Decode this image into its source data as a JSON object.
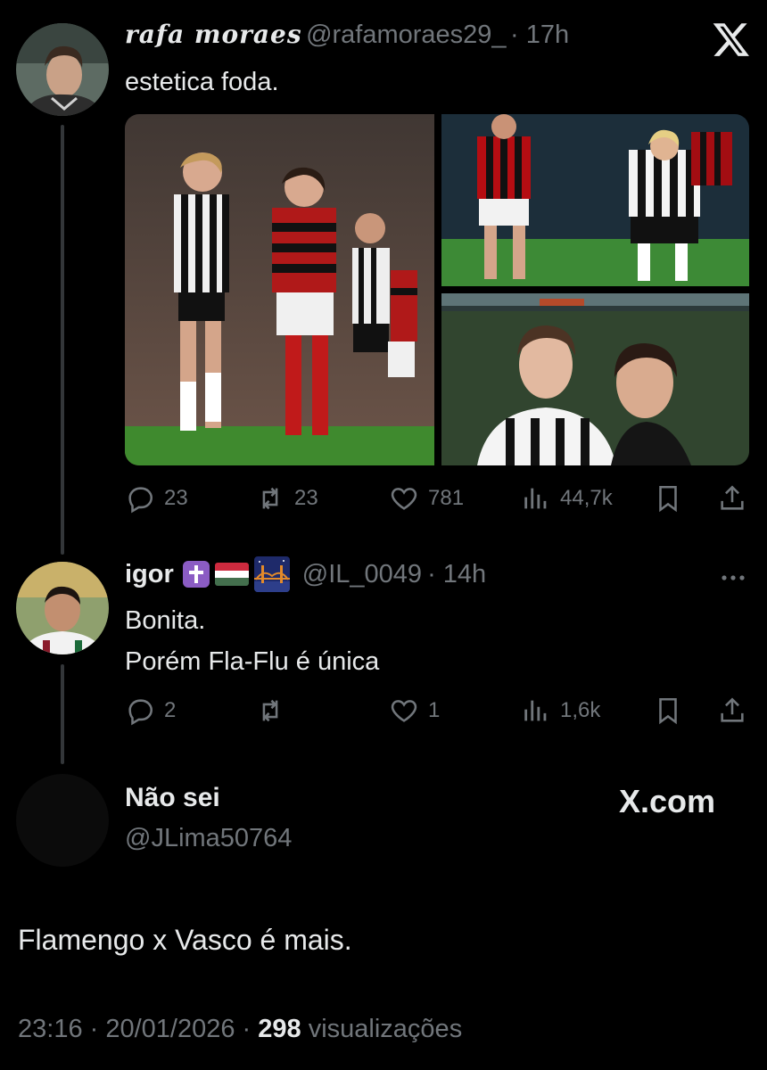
{
  "tweet": {
    "display_name": "rafa moraes",
    "handle": "@rafamoraes29_",
    "time": "· 17h",
    "text": "estetica foda.",
    "stats": {
      "replies": "23",
      "reposts": "23",
      "likes": "781",
      "views": "44,7k"
    }
  },
  "reply": {
    "display_name": "igor",
    "handle": "@IL_0049",
    "time": "· 14h",
    "text_line1": "Bonita.",
    "text_line2": "Porém Fla-Flu é única",
    "stats": {
      "replies": "2",
      "reposts": "",
      "likes": "1",
      "views": "1,6k"
    }
  },
  "quoted": {
    "display_name": "Não sei",
    "handle": "@JLima50764",
    "brand": "X.com",
    "text": "Flamengo x Vasco é mais.",
    "timestamp": "23:16 · 20/01/2026 ·",
    "views_count": "298",
    "views_label": "visualizações"
  },
  "icons": {
    "close": "x-logo-icon",
    "reply": "speech-bubble-icon",
    "repost": "repost-arrows-icon",
    "like": "heart-icon",
    "views": "bar-chart-icon",
    "bookmark": "bookmark-icon",
    "share": "share-icon",
    "more": "more-dots-icon"
  },
  "colors": {
    "background": "#000000",
    "text": "#e7e9ea",
    "muted": "#71767b",
    "divider": "#333639"
  }
}
